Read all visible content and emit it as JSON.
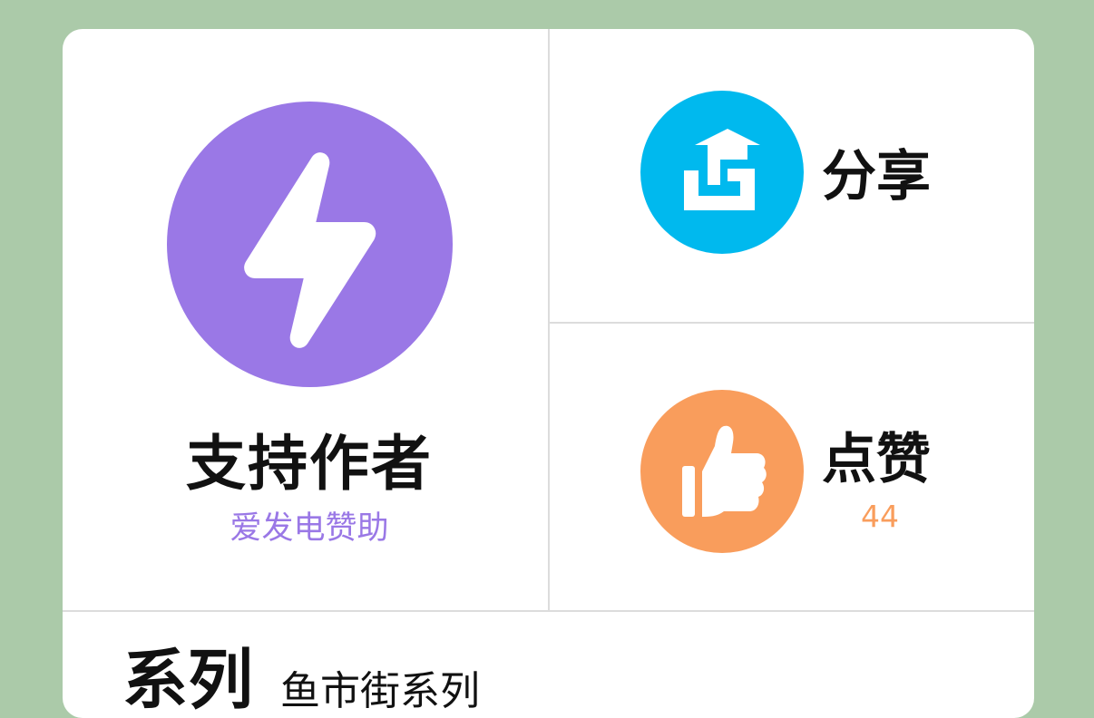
{
  "support": {
    "title": "支持作者",
    "subtitle": "爱发电赞助",
    "icon": "lightning-icon",
    "color": "#9a78e6"
  },
  "share": {
    "label": "分享",
    "icon": "share-icon",
    "color": "#00b9ee"
  },
  "like": {
    "label": "点赞",
    "count": "44",
    "icon": "thumbs-up-icon",
    "color": "#f99d5c"
  },
  "series": {
    "title": "系列",
    "name": "鱼市街系列"
  }
}
